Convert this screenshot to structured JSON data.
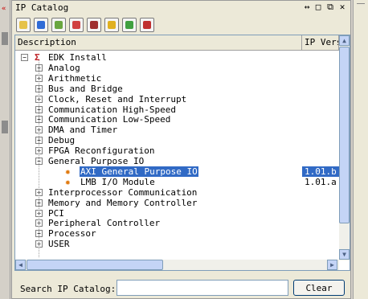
{
  "panel": {
    "title": "IP Catalog",
    "controls": [
      "↔",
      "□",
      "⧉",
      "✕"
    ]
  },
  "toolbar": {
    "buttons": [
      {
        "name": "new-ip-button",
        "color": "#e6c24a"
      },
      {
        "name": "add-ip-button",
        "color": "#2f6bd6"
      },
      {
        "name": "config-button",
        "color": "#6aa640"
      },
      {
        "name": "view-button",
        "color": "#d04040"
      },
      {
        "name": "record-button",
        "color": "#a03030"
      },
      {
        "name": "lock-button",
        "color": "#e0b020"
      },
      {
        "name": "settings-button",
        "color": "#40a040"
      },
      {
        "name": "library-button",
        "color": "#c03030"
      }
    ]
  },
  "table": {
    "col_description": "Description",
    "col_version": "IP Versi",
    "root": "EDK Install",
    "categories": [
      "Analog",
      "Arithmetic",
      "Bus and Bridge",
      "Clock, Reset and Interrupt",
      "Communication High-Speed",
      "Communication Low-Speed",
      "DMA and Timer",
      "Debug",
      "FPGA Reconfiguration",
      "General Purpose IO"
    ],
    "gpio_children": [
      {
        "label": "AXI General Purpose IO",
        "version": "1.01.b",
        "selected": true
      },
      {
        "label": "LMB I/O Module",
        "version": "1.01.a",
        "selected": false
      }
    ],
    "categories_after": [
      "Interprocessor Communication",
      "Memory and Memory Controller",
      "PCI",
      "Peripheral Controller",
      "Processor",
      "USER"
    ]
  },
  "search": {
    "label": "Search IP Catalog:",
    "value": "",
    "clear_label": "Clear"
  },
  "colors": {
    "selection": "#316ac5",
    "scrollbar": "#c4d4f6",
    "edk_icon": "#c0282d"
  }
}
